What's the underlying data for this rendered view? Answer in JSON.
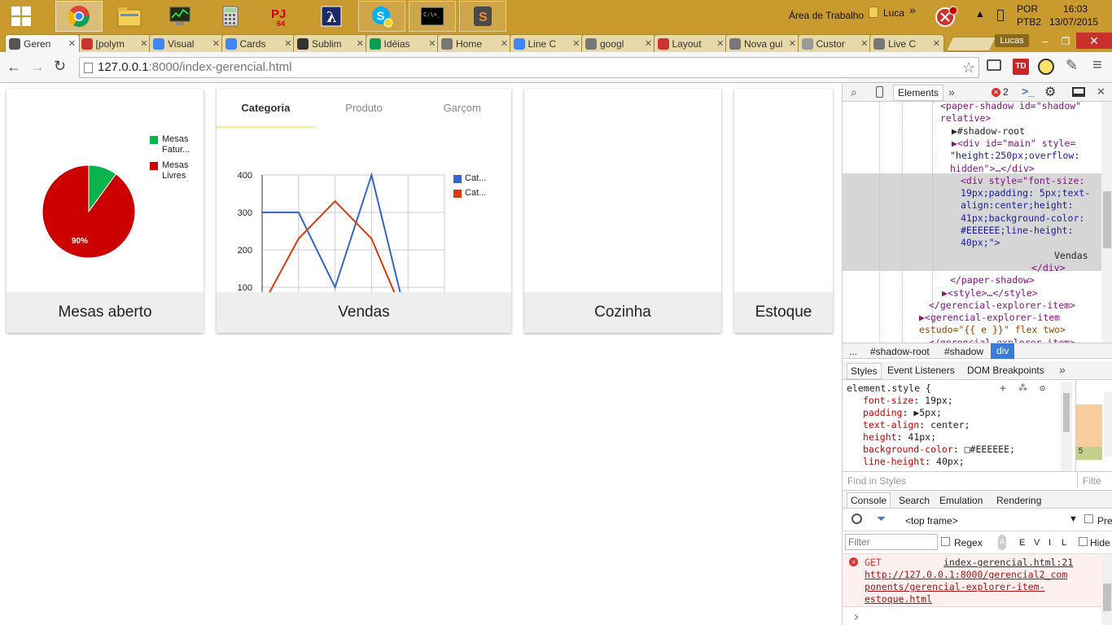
{
  "taskbar": {
    "tray_desktop": "Área de Trabalho",
    "tray_user": "Luca",
    "lang": "POR",
    "layout": "PTB2",
    "time": "16:03",
    "date": "13/07/2015"
  },
  "browser": {
    "tabs": [
      {
        "label": "Geren",
        "icon": "page-icon",
        "color": "#555"
      },
      {
        "label": "[polym",
        "icon": "gmail-icon",
        "color": "#c33"
      },
      {
        "label": "Visual",
        "icon": "drive-icon",
        "color": "#4285f4"
      },
      {
        "label": "Cards",
        "icon": "google-icon",
        "color": "#4285f4"
      },
      {
        "label": "Sublim",
        "icon": "sublime-icon",
        "color": "#333"
      },
      {
        "label": "Idéias",
        "icon": "drive-icon",
        "color": "#0a9d58"
      },
      {
        "label": "Home",
        "icon": "home-icon",
        "color": "#777"
      },
      {
        "label": "Line C",
        "icon": "chart-icon",
        "color": "#4285f4"
      },
      {
        "label": "googl",
        "icon": "page-icon",
        "color": "#777"
      },
      {
        "label": "Layout",
        "icon": "polymer-icon",
        "color": "#c33"
      },
      {
        "label": "Nova gui",
        "icon": "blank-icon",
        "color": "#777"
      },
      {
        "label": "Custor",
        "icon": "gear-icon",
        "color": "#999"
      },
      {
        "label": "Live C",
        "icon": "page-icon",
        "color": "#777"
      }
    ],
    "user_badge": "Lucas",
    "url_scheme": "127.0.0.1",
    "url_rest": ":8000/index-gerencial.html"
  },
  "cards": {
    "mesas": {
      "footer": "Mesas aberto",
      "pie_label": "90%",
      "legend": [
        {
          "label": "Mesas",
          "label2": "Fatur...",
          "color": "#0ab34c"
        },
        {
          "label": "Mesas",
          "label2": "Livres",
          "color": "#cc0000"
        }
      ]
    },
    "vendas": {
      "footer": "Vendas",
      "tabs": [
        "Categoria",
        "Produto",
        "Garçom"
      ],
      "legend": [
        "Cat...",
        "Cat..."
      ]
    },
    "cozinha": {
      "footer": "Cozinha"
    },
    "estoque": {
      "footer": "Estoque"
    }
  },
  "chart_data": [
    {
      "type": "pie",
      "categories": [
        "Mesas Fatur...",
        "Mesas Livres"
      ],
      "values": [
        10,
        90
      ],
      "colors": [
        "#0ab34c",
        "#cc0000"
      ],
      "title": "",
      "data_labels": [
        "",
        "90%"
      ],
      "legend_position": "right"
    },
    {
      "type": "line",
      "x": [
        0,
        1,
        2,
        3,
        4,
        5
      ],
      "series": [
        {
          "name": "Cat...",
          "color": "#3366cc",
          "values": [
            300,
            300,
            100,
            400,
            0,
            null
          ]
        },
        {
          "name": "Cat...",
          "color": "#dc3912",
          "values": [
            50,
            230,
            330,
            230,
            0,
            null
          ]
        }
      ],
      "ylim": [
        100,
        400
      ],
      "yticks": [
        100,
        200,
        300,
        400
      ],
      "grid": true,
      "legend_position": "right"
    }
  ],
  "devtools": {
    "tab_elements": "Elements",
    "error_count": "2",
    "code_lines": [
      {
        "text": "<paper-shadow id=\"shadow\"",
        "cls": "tag"
      },
      {
        "text": "relative>",
        "cls": "tag"
      },
      {
        "text": "▶#shadow-root",
        "cls": "txt"
      },
      {
        "text": "▶<div id=\"main\" style=",
        "cls": "tag"
      },
      {
        "text": "\"height:250px;overflow:",
        "cls": "val"
      },
      {
        "text": "hidden\">…</div>",
        "cls": "tag"
      },
      {
        "text": "<div style=\"font-size:",
        "cls": "tag"
      },
      {
        "text": "19px;padding: 5px;text-",
        "cls": "val"
      },
      {
        "text": "align:center;height:",
        "cls": "val"
      },
      {
        "text": "41px;background-color:",
        "cls": "val"
      },
      {
        "text": "#EEEEEE;line-height:",
        "cls": "val"
      },
      {
        "text": "40px;\">",
        "cls": "val"
      },
      {
        "text": "Vendas",
        "cls": "txt"
      },
      {
        "text": "</div>",
        "cls": "tag"
      },
      {
        "text": "</paper-shadow>",
        "cls": "tag"
      },
      {
        "text": "▶<style>…</style>",
        "cls": "tag"
      },
      {
        "text": "</gerencial-explorer-item>",
        "cls": "tag"
      },
      {
        "text": "▶<gerencial-explorer-item",
        "cls": "tag"
      },
      {
        "text": "estudo=\"{{ e }}\" flex two>",
        "cls": "attr"
      },
      {
        "text": "</gerencial-explorer-item>",
        "cls": "tag"
      }
    ],
    "breadcrumb": [
      "...",
      "#shadow-root",
      "#shadow",
      "div"
    ],
    "styles_tabs": [
      "Styles",
      "Event Listeners",
      "DOM Breakpoints"
    ],
    "element_style": "element.style {",
    "style_props": [
      {
        "prop": "font-size",
        "val": "19px;"
      },
      {
        "prop": "padding",
        "val": "▶5px;"
      },
      {
        "prop": "text-align",
        "val": "center;"
      },
      {
        "prop": "height",
        "val": "41px;"
      },
      {
        "prop": "background-color",
        "val": "□#EEEEEE;"
      },
      {
        "prop": "line-height",
        "val": "40px;"
      }
    ],
    "find_styles": "Find in Styles",
    "filter_right": "Filte",
    "drawer_tabs": [
      "Console",
      "Search",
      "Emulation",
      "Rendering"
    ],
    "frame": "<top frame>",
    "preserve": "Pre",
    "filter_placeholder": "Filter",
    "regex": "Regex",
    "levels": [
      "A",
      "E",
      "V",
      "I",
      "L"
    ],
    "hide": "Hide",
    "error_method": "GET",
    "error_source": "index-gerencial.html:21",
    "error_url_1": "http://127.0.0.1:8000/gerencial2_com",
    "error_url_2": "ponents/gerencial-explorer-item-",
    "error_url_3": "estoque.html",
    "prompt": "›"
  }
}
